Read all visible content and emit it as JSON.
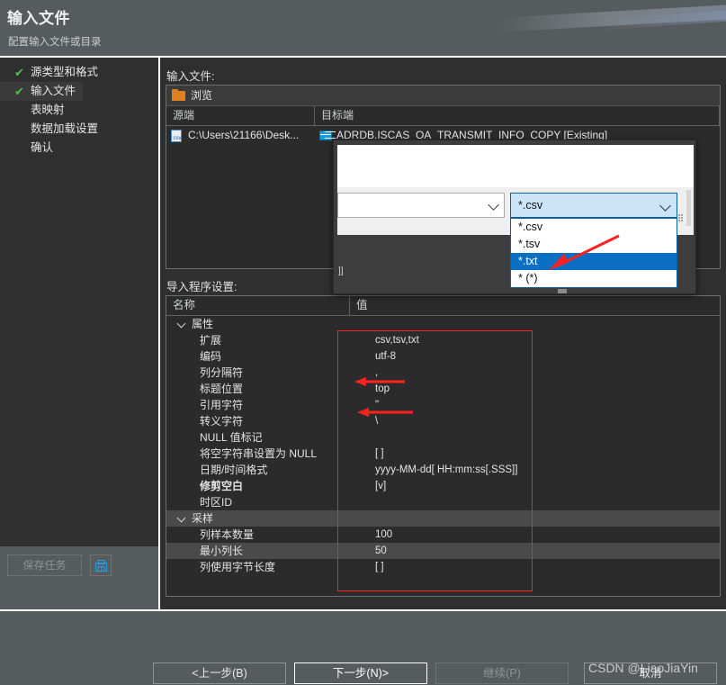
{
  "header": {
    "title": "输入文件",
    "subtitle": "配置输入文件或目录"
  },
  "sidebar": {
    "items": [
      {
        "label": "源类型和格式",
        "checked": true,
        "active": false
      },
      {
        "label": "输入文件",
        "checked": true,
        "active": true
      },
      {
        "label": "表映射",
        "checked": false,
        "active": false
      },
      {
        "label": "数据加载设置",
        "checked": false,
        "active": false
      },
      {
        "label": "确认",
        "checked": false,
        "active": false
      }
    ],
    "save_task_label": "保存任务",
    "save_icon_name": "save-disk-icon"
  },
  "main": {
    "input_files_label": "输入文件:",
    "importer_label": "导入程序设置:",
    "file_table": {
      "browse_label": "浏览",
      "browse_icon": "folder-icon",
      "columns": [
        "源端",
        "目标端"
      ],
      "rows": [
        {
          "source": "C:\\Users\\21166\\Desk...",
          "source_icon": "csv-file-icon",
          "target": "ADRDB.ISCAS_OA_TRANSMIT_INFO_COPY [Existing]",
          "target_icon": "database-table-icon"
        }
      ]
    },
    "props_table": {
      "columns": [
        "名称",
        "值"
      ],
      "rows": [
        {
          "name": "属性",
          "value": "",
          "type": "group",
          "alt": false,
          "bold": false
        },
        {
          "name": "扩展",
          "value": "csv,tsv,txt",
          "type": "child",
          "alt": false,
          "bold": false
        },
        {
          "name": "编码",
          "value": "utf-8",
          "type": "child",
          "alt": false,
          "bold": false
        },
        {
          "name": "列分隔符",
          "value": ",",
          "type": "child",
          "alt": false,
          "bold": false
        },
        {
          "name": "标题位置",
          "value": "top",
          "type": "child",
          "alt": false,
          "bold": false
        },
        {
          "name": "引用字符",
          "value": "\"",
          "type": "child",
          "alt": false,
          "bold": false
        },
        {
          "name": "转义字符",
          "value": "\\",
          "type": "child",
          "alt": false,
          "bold": false
        },
        {
          "name": "NULL 值标记",
          "value": "",
          "type": "child",
          "alt": false,
          "bold": false
        },
        {
          "name": "将空字符串设置为 NULL",
          "value": "[ ]",
          "type": "child",
          "alt": false,
          "bold": false
        },
        {
          "name": "日期/时间格式",
          "value": "yyyy-MM-dd[ HH:mm:ss[.SSS]]",
          "type": "child",
          "alt": false,
          "bold": false
        },
        {
          "name": "修剪空白",
          "value": "[v]",
          "type": "child",
          "alt": false,
          "bold": true
        },
        {
          "name": "时区ID",
          "value": "",
          "type": "child",
          "alt": false,
          "bold": false
        },
        {
          "name": "采样",
          "value": "",
          "type": "group",
          "alt": true,
          "bold": false
        },
        {
          "name": "列样本数量",
          "value": "100",
          "type": "child",
          "alt": false,
          "bold": false
        },
        {
          "name": "最小列长",
          "value": "50",
          "type": "child",
          "alt": true,
          "bold": false
        },
        {
          "name": "列使用字节长度",
          "value": "[ ]",
          "type": "child",
          "alt": false,
          "bold": false
        }
      ]
    }
  },
  "overlay": {
    "combo_selected": "*.csv",
    "options": [
      {
        "label": "*.csv",
        "selected": false
      },
      {
        "label": "*.tsv",
        "selected": false
      },
      {
        "label": "*.txt",
        "selected": true
      },
      {
        "label": "* (*)",
        "selected": false
      }
    ],
    "low_text": "]]",
    "annotation_number": "1"
  },
  "footer": {
    "prev": "<上一步(B)",
    "next": "下一步(N)>",
    "continue": "继续(P)",
    "cancel": "取消"
  },
  "watermark": {
    "text": "CSDN @LiaoJiaYin"
  },
  "colors": {
    "header_bg": "#565b5d",
    "panel_bg": "#2f2f2f",
    "table_bg": "#2b2b2b",
    "row_alt": "#4a4a4a",
    "accent_green": "#4ec14e",
    "accent_orange": "#e08020",
    "accent_blue": "#0a6fc2",
    "annotation_red": "#ff2020"
  }
}
